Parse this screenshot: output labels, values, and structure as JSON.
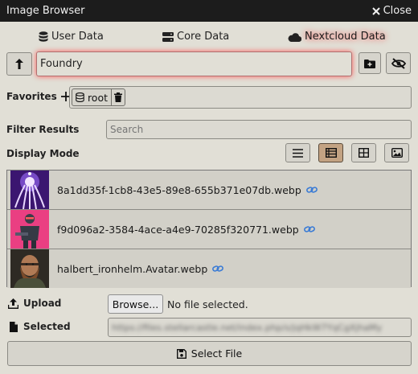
{
  "window": {
    "title": "Image Browser",
    "close_label": "Close"
  },
  "tabs": [
    {
      "label": "User Data",
      "icon": "database-icon",
      "active": false
    },
    {
      "label": "Core Data",
      "icon": "server-icon",
      "active": false
    },
    {
      "label": "Nextcloud Data",
      "icon": "cloud-icon",
      "active": true
    }
  ],
  "path": {
    "value": "Foundry"
  },
  "favorites": {
    "label": "Favorites",
    "items": [
      {
        "label": "root"
      }
    ]
  },
  "filter": {
    "label": "Filter Results",
    "placeholder": "Search"
  },
  "display_mode": {
    "label": "Display Mode",
    "modes": [
      "list",
      "details",
      "tiles",
      "images"
    ],
    "active": "details"
  },
  "files": [
    {
      "name": "8a1dd35f-1cb8-43e5-89e8-655b371e07db.webp"
    },
    {
      "name": "f9d096a2-3584-4ace-a4e9-70285f320771.webp"
    },
    {
      "name": "halbert_ironhelm.Avatar.webp"
    }
  ],
  "upload": {
    "label": "Upload",
    "browse_label": "Browse...",
    "status": "No file selected."
  },
  "selected": {
    "label": "Selected",
    "value": "https://files.stellarcastle.net/index.php/s/jqHkW7YqCgXjhaMy"
  },
  "footer": {
    "select_label": "Select File"
  },
  "colors": {
    "accent_glow": "#ff3c3c",
    "link_icon": "#3a7bd5"
  }
}
